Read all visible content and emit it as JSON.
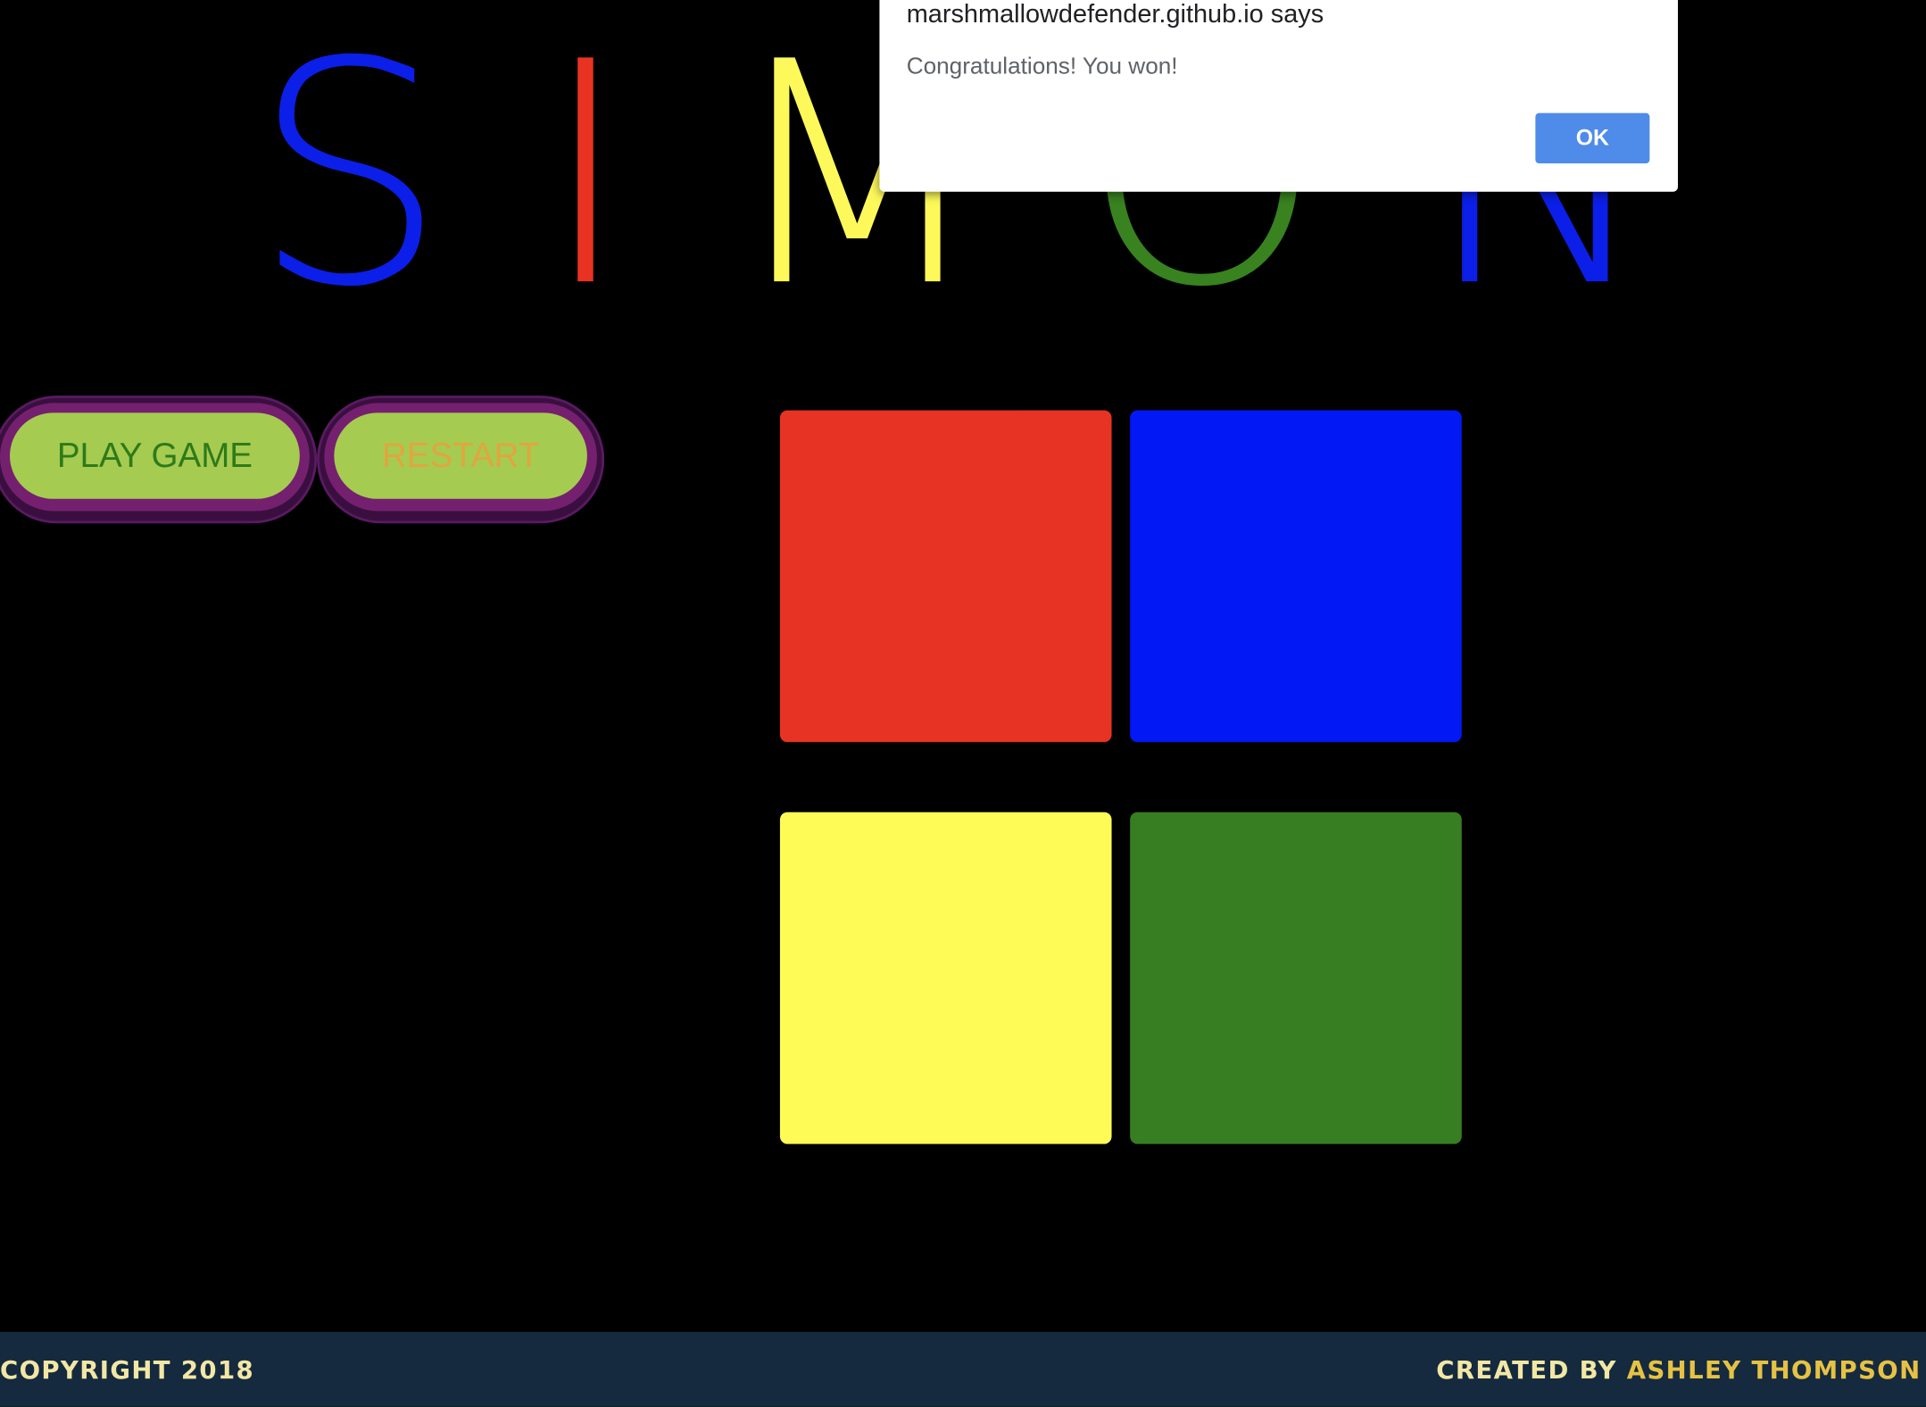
{
  "title": {
    "letters": [
      {
        "char": "S",
        "color": "#0b1fe8"
      },
      {
        "char": "I",
        "color": "#e83323"
      },
      {
        "char": "M",
        "color": "#fdf95a"
      },
      {
        "char": "O",
        "color": "#38821f"
      },
      {
        "char": "N",
        "color": "#0b1fe8"
      }
    ]
  },
  "controls": {
    "play_label": "PLAY GAME",
    "play_color": "#2e7a19",
    "restart_label": "RESTART",
    "restart_color": "#e0a640"
  },
  "pads": [
    {
      "name": "red",
      "color": "#e73323"
    },
    {
      "name": "blue",
      "color": "#0219f5"
    },
    {
      "name": "yellow",
      "color": "#fefb56"
    },
    {
      "name": "green",
      "color": "#377e22"
    }
  ],
  "footer": {
    "copyright": "COPYRIGHT 2018",
    "created_by": "CREATED BY",
    "author": "ASHLEY THOMPSON"
  },
  "dialog": {
    "origin": "marshmallowdefender.github.io says",
    "message": "Congratulations! You won!",
    "ok_label": "OK"
  }
}
